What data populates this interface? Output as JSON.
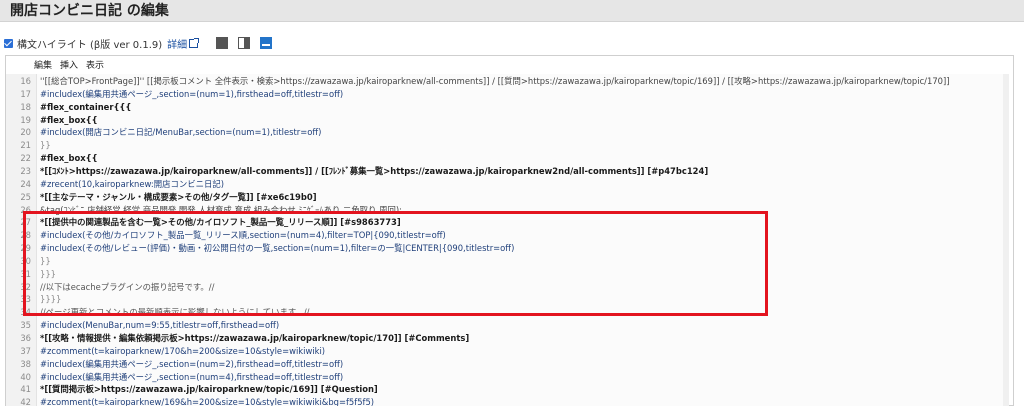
{
  "page": {
    "title": "開店コンビニ日記 の編集"
  },
  "options": {
    "checkbox_checked": true,
    "label": "構文ハイライト (β版 ver 0.1.9)",
    "details_link": "詳細",
    "layout_buttons": [
      "layout-editor-only-icon",
      "layout-split-icon",
      "layout-preview-icon"
    ]
  },
  "menu": {
    "edit": "編集",
    "insert": "挿入",
    "view": "表示"
  },
  "highlight_color": "#e3141f",
  "lines": [
    {
      "n": "16",
      "t": "''[[総合TOP>FrontPage]]'' [[掲示板コメント 全件表示・検索>https://zawazawa.jp/kairoparknew/all-comments]] / [[質問>https://zawazawa.jp/kairoparknew/topic/169]] / [[攻略>https://zawazawa.jp/kairoparknew/topic/170]]",
      "s": "c-link"
    },
    {
      "n": "17",
      "t": "#includex(編集用共通ページ_,section=(num=1),firsthead=off,titlestr=off)",
      "s": "c-dir"
    },
    {
      "n": "18",
      "t": "#flex_container{{{",
      "s": "c-bold"
    },
    {
      "n": "19",
      "t": "#flex_box{{",
      "s": "c-bold"
    },
    {
      "n": "20",
      "t": "#includex(開店コンビニ日記/MenuBar,section=(num=1),titlestr=off)",
      "s": "c-dir"
    },
    {
      "n": "21",
      "t": "}}",
      "s": "c-brace"
    },
    {
      "n": "22",
      "t": "#flex_box{{",
      "s": "c-bold"
    },
    {
      "n": "23",
      "t": "*[[ｺﾒﾝﾄ>https://zawazawa.jp/kairoparknew/all-comments]] / [[ﾌﾚﾝﾄﾞ募集一覧>https://zawazawa.jp/kairoparknew2nd/all-comments]] [#p47bc124]",
      "s": "c-bold"
    },
    {
      "n": "24",
      "t": "#zrecent(10,kairoparknew:開店コンビニ日記)",
      "s": "c-dir"
    },
    {
      "n": "25",
      "t": "*[[主なテーマ・ジャンル・構成要素>その他/タグ一覧]] [#xe6c19b0]",
      "s": "c-bold"
    },
    {
      "n": "26",
      "t": "&tag(ｺﾝﾋﾞﾆ,店舗経営,経営,商品開発,開発,人材育成,育成,組み合わせ,ﾐﾆｹﾞｰﾑあり,二角取り,周回);",
      "s": "c-link"
    },
    {
      "n": "27",
      "t": "*[[提供中の関連製品を含む一覧>その他/カイロソフト_製品一覧_リリース順]] [#s9863773]",
      "s": "c-bold"
    },
    {
      "n": "28",
      "t": "#includex(その他/カイロソフト_製品一覧_リリース順,section=(num=4),filter=TOP|{090,titlestr=off)",
      "s": "c-dir"
    },
    {
      "n": "29",
      "t": "#includex(その他/レビュー(評価)・動画・初公開日付の一覧,section=(num=1),filter=の一覧|CENTER|{090,titlestr=off)",
      "s": "c-dir"
    },
    {
      "n": "30",
      "t": "}}",
      "s": "c-brace"
    },
    {
      "n": "31",
      "t": "}}}",
      "s": "c-brace"
    },
    {
      "n": "32",
      "t": "//以下はecacheプラグインの振り記号です。//",
      "s": "c-comment"
    },
    {
      "n": "33",
      "t": "}}}}",
      "s": "c-brace"
    },
    {
      "n": "34",
      "t": "//ページ更新とコメントの最新順表示に影響しないようにしています。//",
      "s": "c-comment"
    },
    {
      "n": "35",
      "t": "#includex(MenuBar,num=9:55,titlestr=off,firsthead=off)",
      "s": "c-dir"
    },
    {
      "n": "36",
      "t": "*[[攻略・情報提供・編集依頼掲示板>https://zawazawa.jp/kairoparknew/topic/170]] [#Comments]",
      "s": "c-bold"
    },
    {
      "n": "37",
      "t": "#zcomment(t=kairoparknew/170&h=200&size=10&style=wikiwiki)",
      "s": "c-dir"
    },
    {
      "n": "38",
      "t": "#includex(編集用共通ページ_,section=(num=2),firsthead=off,titlestr=off)",
      "s": "c-dir"
    },
    {
      "n": "40",
      "t": "#includex(編集用共通ページ_,section=(num=4),firsthead=off,titlestr=off)",
      "s": "c-dir"
    },
    {
      "n": "41",
      "t": "*[[質問掲示板>https://zawazawa.jp/kairoparknew/topic/169]] [#Question]",
      "s": "c-bold"
    },
    {
      "n": "42",
      "t": "#zcomment(t=kairoparknew/169&h=200&size=10&style=wikiwiki&bg=f5f5f5)",
      "s": "c-dir"
    }
  ]
}
